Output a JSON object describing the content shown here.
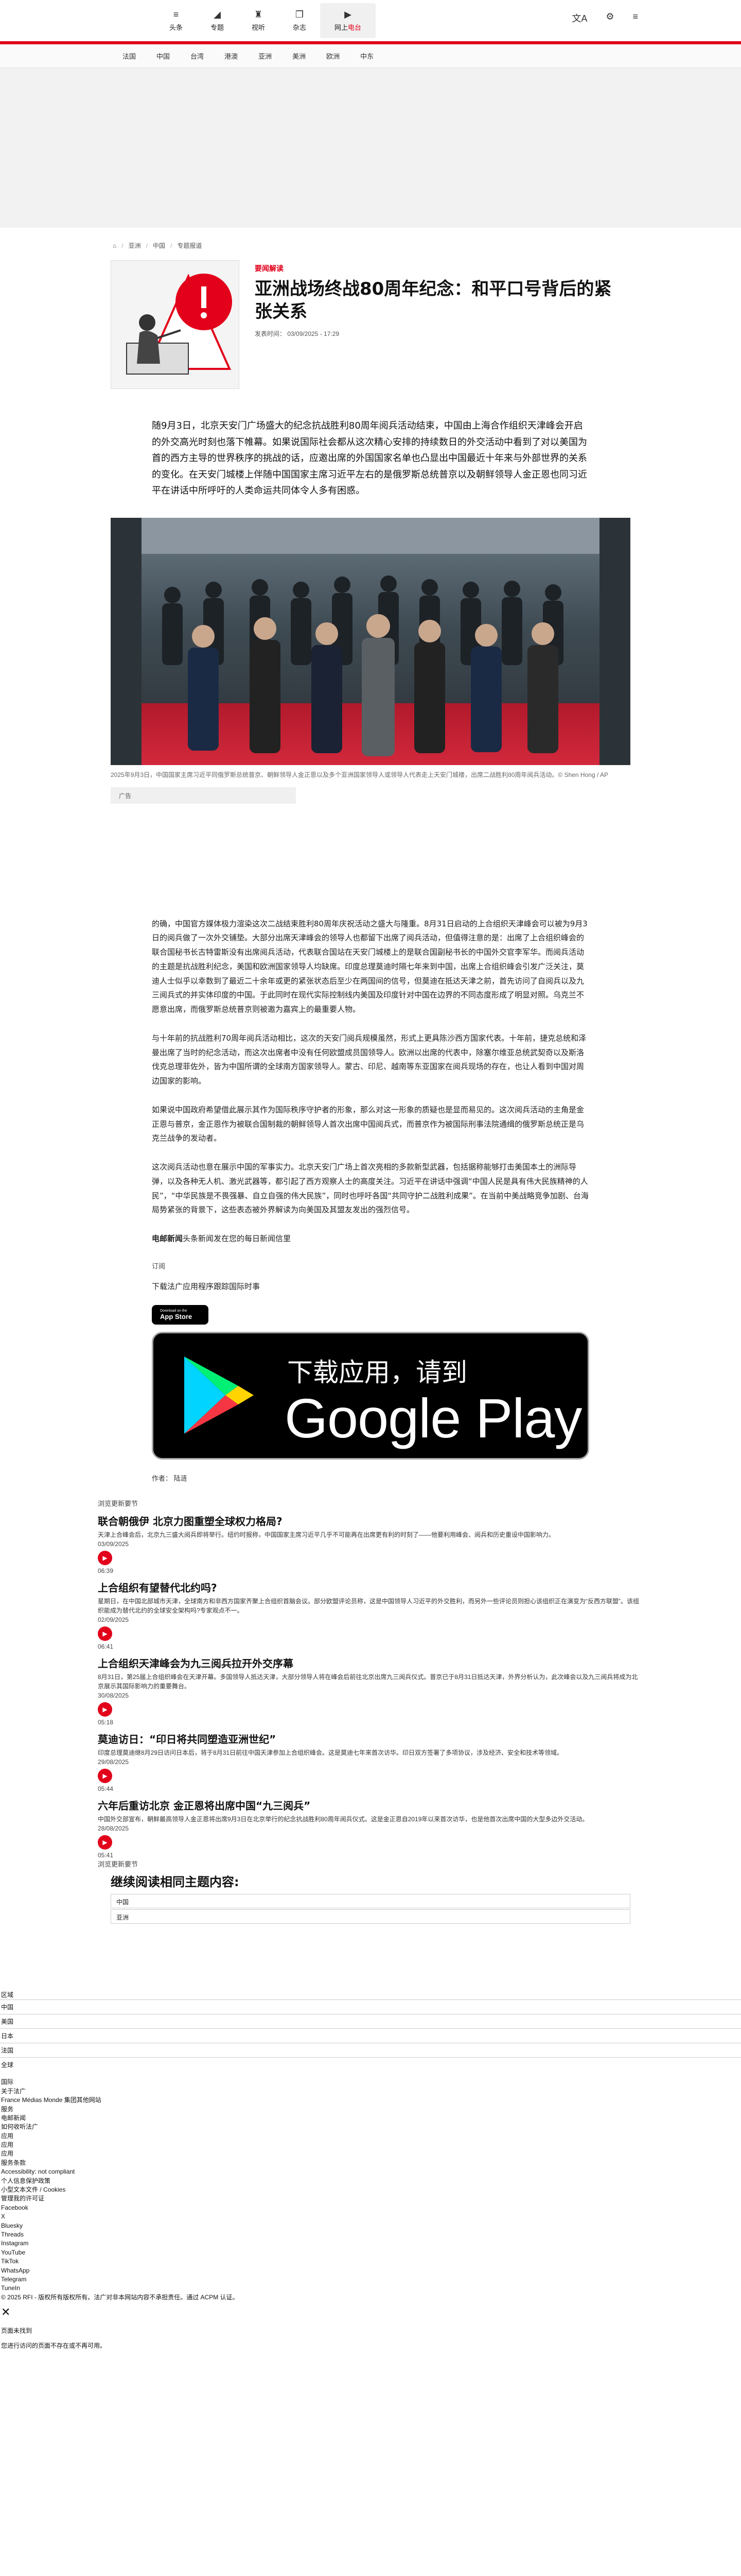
{
  "topnav": {
    "items": [
      {
        "icon": "≡",
        "label": "头条"
      },
      {
        "icon": "◢",
        "label": "专题"
      },
      {
        "icon": "♜",
        "label": "视听"
      },
      {
        "icon": "❐",
        "label": "杂志"
      }
    ],
    "live_prefix": "▶",
    "live_label": "网上",
    "live_accent": "电台"
  },
  "topbar_right": {
    "translate": "文A",
    "settings": "⚙",
    "menu": "≡"
  },
  "subnav": [
    "法国",
    "中国",
    "台湾",
    "港澳",
    "亚洲",
    "美洲",
    "欧洲",
    "中东"
  ],
  "breadcrumb": {
    "home": "⌂",
    "level1": "亚洲",
    "level2": "中国",
    "level3": "专题报道"
  },
  "article": {
    "kicker": "要闻解读",
    "title": "亚洲战场终战80周年纪念：和平口号背后的紧张关系",
    "pubdate": "发表时间： 03/09/2025 - 17:29",
    "lead": "随9月3日，北京天安门广场盛大的纪念抗战胜利80周年阅兵活动结束，中国由上海合作组织天津峰会开启的外交高光时刻也落下帷幕。如果说国际社会都从这次精心安排的持续数日的外交活动中看到了对以美国为首的西方主导的世界秩序的挑战的话，应邀出席的外国国家名单也凸显出中国最近十年来与外部世界的关系的变化。在天安门城楼上伴随中国国家主席习近平左右的是俄罗斯总统普京以及朝鲜领导人金正恩也同习近平在讲话中所呼吁的人类命运共同体令人多有困惑。",
    "caption": "2025年9月3日，中国国家主席习近平同俄罗斯总统普京、朝鲜领导人金正恩以及多个亚洲国家领导人或领导人代表走上天安门城楼，出席二战胜利80周年阅兵活动。© Shen Hong / AP",
    "ad_label": "广告",
    "paragraphs": [
      "的确，中国官方媒体极力渲染这次二战结束胜利80周年庆祝活动之盛大与隆重。8月31日启动的上合组织天津峰会可以被为9月3日的阅兵做了一次外交铺垫。大部分出席天津峰会的领导人也都留下出席了阅兵活动，但值得注意的是：出席了上合组织峰会的联合国秘书长古特雷斯没有出席阅兵活动，代表联合国站在天安门城楼上的是联合国副秘书长的中国外交官李军华。而阅兵活动的主题是抗战胜利纪念，美国和欧洲国家领导人均缺席。印度总理莫迪时隔七年来到中国，出席上合组织峰会引发广泛关注，莫迪人士似乎以幸数到了最近二十余年或更的紧张状态后至少在两国间的信号，但莫迪在抵达天津之前，首先访问了自阅兵以及九三阅兵式的并实体印度的中国。于此同时在现代实际控制线内美国及印度针对中国在边界的不同态度形成了明显对照。乌克兰不愿意出席，而俄罗斯总统普京则被邀为嘉宾上的最重要人物。",
      "与十年前的抗战胜利70周年阅兵活动相比，这次的天安门阅兵规模虽然，形式上更具陈沙西方国家代表。十年前，捷克总统和泽曼出席了当时的纪念活动，而这次出席者中没有任何欧盟成员国领导人。欧洲以出席的代表中，除塞尔维亚总统武契奇以及斯洛伐克总理菲佐外，皆为中国所谓的全球南方国家领导人。蒙古、印尼、越南等东亚国家在阅兵现场的存在，也让人看到中国对周边国家的影响。",
      "如果说中国政府希望借此展示其作为国际秩序守护者的形象，那么对这一形象的质疑也是显而易见的。这次阅兵活动的主角是金正恩与普京，金正恩作为被联合国制裁的朝鲜领导人首次出席中国阅兵式，而普京作为被国际刑事法院通缉的俄罗斯总统正是乌克兰战争的发动者。",
      "这次阅兵活动也意在展示中国的军事实力。北京天安门广场上首次亮相的多款新型武器，包括据称能够打击美国本土的洲际导弹，以及各种无人机、激光武器等，都引起了西方观察人士的高度关注。习近平在讲话中强调“中国人民是具有伟大民族精神的人民”，“中华民族是不畏强暴、自立自强的伟大民族”，同时也呼吁各国“共同守护二战胜利成果”。在当前中美战略竞争加剧、台海局势紧张的背景下，这些表态被外界解读为向美国及其盟友发出的强烈信号。"
    ],
    "source_bold": "电邮新闻",
    "source_rest": "头条新闻发在您的每日新闻信里",
    "tag_line": "订阅",
    "download_cta": "下载法广应用程序跟踪国际时事",
    "appstore_small": "Download on the",
    "appstore_big": "App Store",
    "gp_line1": "下载应用，请到",
    "gp_line2": "Google Play",
    "author": "作者： 陆涟"
  },
  "related": {
    "label": "浏览更新要节",
    "items": [
      {
        "title": "联合朝俄伊 北京力图重塑全球权力格局?",
        "desc": "天津上合峰会后，北京九三盛大阅兵即将举行。纽约时报称，中国国家主席习近平几乎不可能再在出席更有利的时刻了——他要利用峰会、阅兵和历史重设中国影响力。",
        "date": "03/09/2025",
        "dur": "06:39"
      },
      {
        "title": "上合组织有望替代北约吗?",
        "desc": "星期日，在中国北部城市天津，全球南方和非西方国家齐聚上合组织首脑会议。部分欧盟评论员称，这是中国领导人习近平的外交胜利，而另外一些评论员则担心该组织正在演变为“反西方联盟”。该组织能成为替代北约的全球安全架构吗?专家观点不一。",
        "date": "02/09/2025",
        "dur": "06:41"
      },
      {
        "title": "上合组织天津峰会为九三阅兵拉开外交序幕",
        "desc": "8月31日，第25届上合组织峰会在天津开幕。多国领导人抵达天津，大部分领导人将在峰会后前往北京出席九三阅兵仪式。普京已于8月31日抵达天津，外界分析认为，此次峰会以及九三阅兵将成为北京展示其国际影响力的重要舞台。",
        "date": "30/08/2025",
        "dur": "05:18"
      },
      {
        "title": "莫迪访日：“印日将共同塑造亚洲世纪”",
        "desc": "印度总理莫迪继8月29日访问日本后，将于8月31日前往中国天津参加上合组织峰会。这是莫迪七年来首次访华。印日双方签署了多项协议，涉及经济、安全和技术等领域。",
        "date": "29/08/2025",
        "dur": "05:44"
      },
      {
        "title": "六年后重访北京 金正恩将出席中国“九三阅兵”",
        "desc": "中国外交部宣布，朝鲜最高领导人金正恩将出席9月3日在北京举行的纪念抗战胜利80周年阅兵仪式。这是金正恩自2019年以来首次访华，也是他首次出席中国的大型多边外交活动。",
        "date": "28/08/2025",
        "dur": "05:41"
      }
    ],
    "more_label": "浏览更新要节",
    "continue_title": "继续阅读相同主题内容:",
    "topics": [
      "中国",
      "亚洲"
    ]
  },
  "footer": {
    "region_label": "区域",
    "regions": [
      "中国",
      "美国",
      "日本",
      "法国",
      "全球"
    ],
    "links": [
      "国际",
      "关于法广",
      "France Médias Monde 集团其他网站",
      "服务",
      "电邮新闻",
      "如何收听法广",
      "应用",
      "应用",
      "应用",
      "服务条款",
      "Accessibility: not compliant",
      "个人信息保护政策",
      "小型文本文件 / Cookies",
      "管理我的许可证",
      "Facebook",
      "X",
      "Bluesky",
      "Threads",
      "Instagram",
      "YouTube",
      "TikTok",
      "WhatsApp",
      "Telegram",
      "TuneIn",
      "© 2025 RFI - 版权所有版权所有。法广对非本网站内容不承担责任。通过 ACPM 认证。"
    ],
    "close": "✕",
    "dismiss_label": "页面未找到",
    "notice": "您进行访问的页面不存在或不再可用。"
  }
}
